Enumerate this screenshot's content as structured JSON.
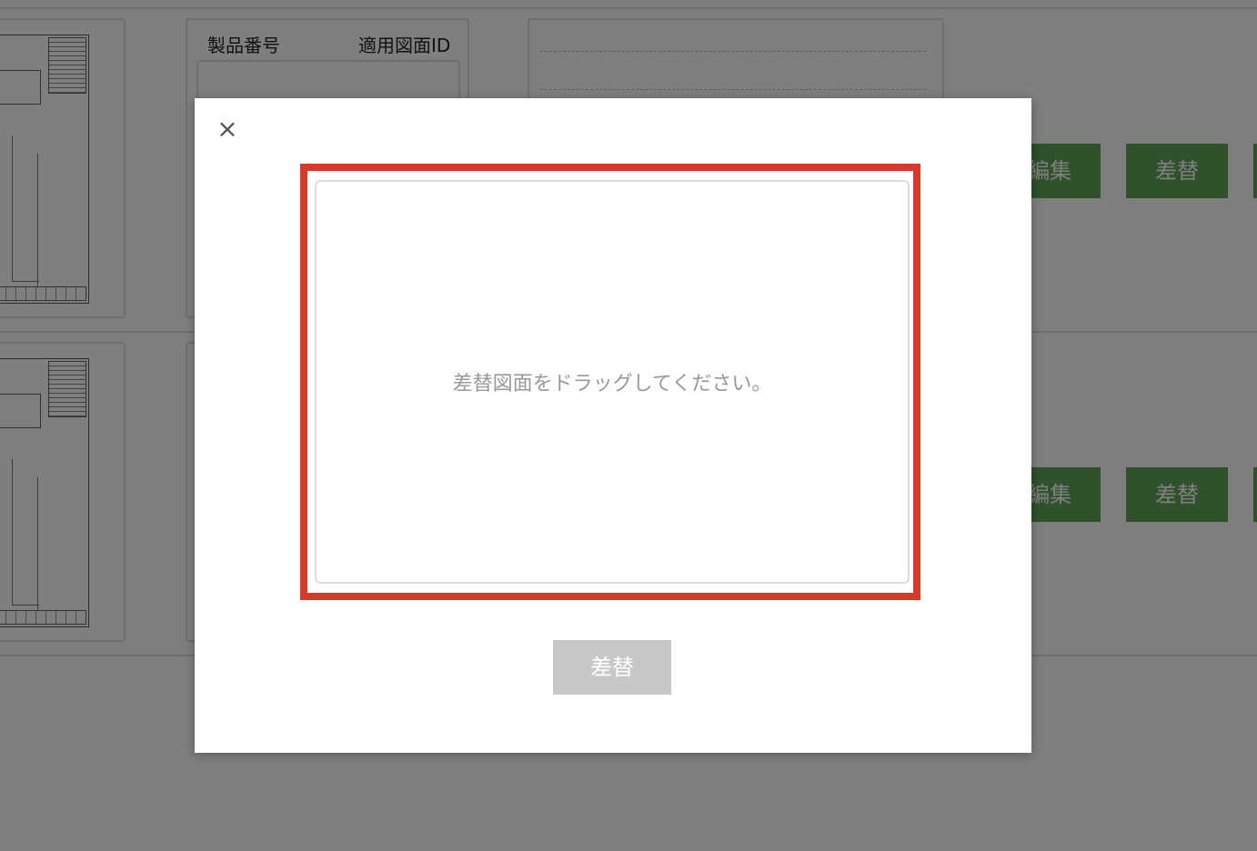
{
  "background": {
    "info_labels": {
      "product_number": "製品番号",
      "drawing_id": "適用図面ID"
    },
    "row_buttons": {
      "edit_label": "編集",
      "replace_label": "差替"
    }
  },
  "modal": {
    "close_glyph": "×",
    "dropzone_text": "差替図面をドラッグしてください。",
    "submit_label": "差替",
    "submit_state": "disabled"
  },
  "colors": {
    "highlight_border": "#d8392b",
    "button_green": "#5fa559",
    "disabled_button": "#c8c8c8",
    "overlay": "rgba(0,0,0,0.5)"
  }
}
